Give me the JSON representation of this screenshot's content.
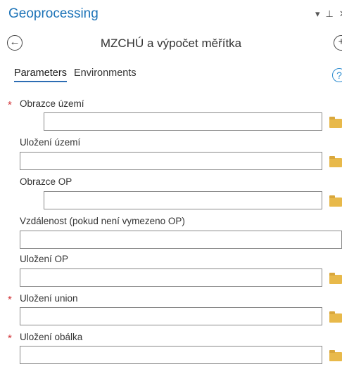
{
  "pane": {
    "title": "Geoprocessing",
    "chevron_icon": "▾",
    "pin_icon": "⊥",
    "close_icon": "✕"
  },
  "tool": {
    "back_icon": "←",
    "title": "MZCHÚ a výpočet měřítka",
    "add_icon": "+"
  },
  "tabs": {
    "parameters": "Parameters",
    "environments": "Environments",
    "help_icon": "?"
  },
  "params": [
    {
      "label": "Obrazce území",
      "required": "*",
      "value": ""
    },
    {
      "label": "Uložení území",
      "required": "",
      "value": ""
    },
    {
      "label": "Obrazce OP",
      "required": "",
      "value": ""
    },
    {
      "label": "Vzdálenost (pokud není vymezeno OP)",
      "required": "",
      "value": ""
    },
    {
      "label": "Uložení OP",
      "required": "",
      "value": ""
    },
    {
      "label": "Uložení union",
      "required": "*",
      "value": ""
    },
    {
      "label": "Uložení obálka",
      "required": "*",
      "value": ""
    }
  ],
  "colors": {
    "accent": "#1e74b8",
    "required": "#d13438",
    "folder": "#e8b94a"
  }
}
